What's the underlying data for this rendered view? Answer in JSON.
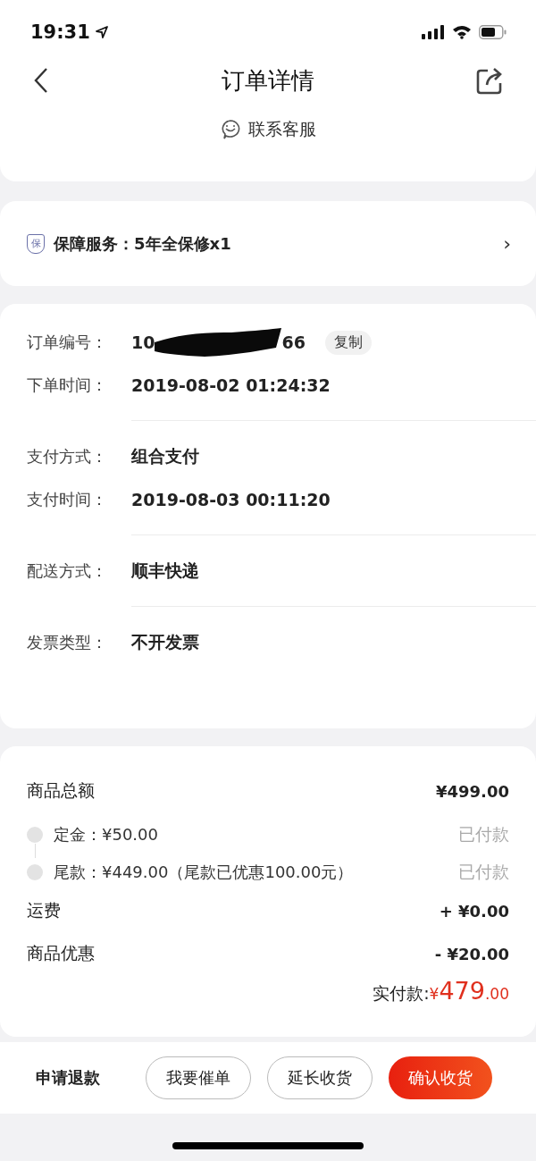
{
  "status_bar": {
    "time": "19:31"
  },
  "header": {
    "title": "订单详情",
    "contact": "联系客服"
  },
  "warranty": {
    "badge": "保",
    "text": "保障服务：5年全保修x1",
    "arrow": "›"
  },
  "order_info": {
    "groups": [
      [
        {
          "label": "订单编号：",
          "kind": "order_number",
          "value_start": "10",
          "value_end": "66",
          "action": "复制"
        },
        {
          "label": "下单时间：",
          "kind": "text",
          "value": "2019-08-02 01:24:32"
        }
      ],
      [
        {
          "label": "支付方式：",
          "kind": "text",
          "value": "组合支付"
        },
        {
          "label": "支付时间：",
          "kind": "text",
          "value": "2019-08-03 00:11:20"
        }
      ],
      [
        {
          "label": "配送方式：",
          "kind": "text",
          "value": "顺丰快递"
        }
      ],
      [
        {
          "label": "发票类型：",
          "kind": "text",
          "value": "不开发票"
        }
      ]
    ]
  },
  "price": {
    "total_label": "商品总额",
    "total": "¥499.00",
    "stages": [
      {
        "text": "定金：¥50.00",
        "status": "已付款"
      },
      {
        "text": "尾款：¥449.00（尾款已优惠100.00元）",
        "status": "已付款"
      }
    ],
    "lines": [
      {
        "label": "运费",
        "value": "+ ¥0.00"
      },
      {
        "label": "商品优惠",
        "value": "- ¥20.00"
      }
    ],
    "paid_label": "实付款:",
    "paid_currency": "¥",
    "paid_int": "479",
    "paid_dec": ".00"
  },
  "actions": [
    {
      "label": "申请退款",
      "kind": "text"
    },
    {
      "label": "我要催单",
      "kind": "outline"
    },
    {
      "label": "延长收货",
      "kind": "outline"
    },
    {
      "label": "确认收货",
      "kind": "primary"
    }
  ]
}
